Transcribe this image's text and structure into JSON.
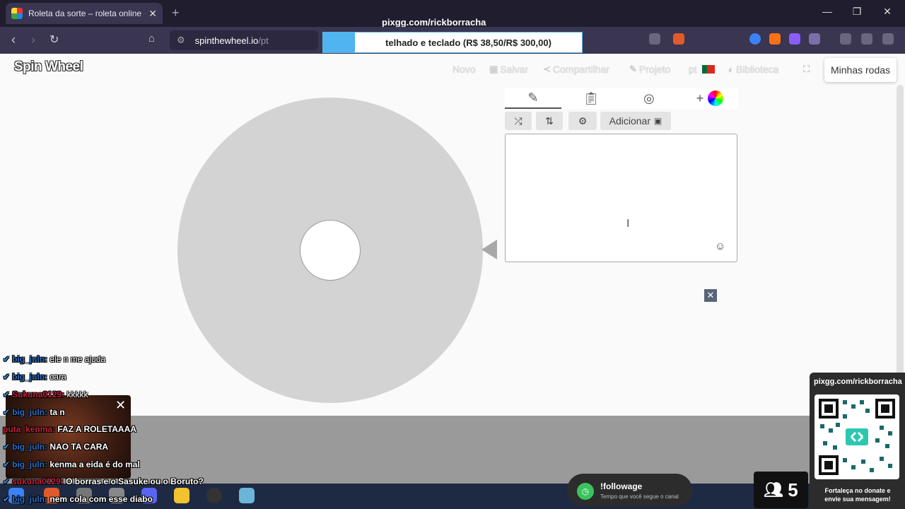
{
  "browser": {
    "tab_title": "Roleta da sorte – roleta online gr",
    "overlay_url": "pixgg.com/rickborracha",
    "address_site": "spinthewheel.io",
    "address_path": "/pt",
    "promo_text": "telhado e teclado (R$ 38,50/R$ 300,00)"
  },
  "site": {
    "logo": "Spin Wheel",
    "menu": {
      "novo": "Novo",
      "salvar": "Salvar",
      "compartilhar": "Compartilhar",
      "projeto": "Projeto",
      "lang": "pt",
      "biblioteca": "Biblioteca"
    },
    "minhas_rodas": "Minhas rodas"
  },
  "editor": {
    "add_label": "Adicionar",
    "entries_text": ""
  },
  "chat": [
    {
      "user": "big_juln:",
      "text": "ele n me ajuda"
    },
    {
      "user": "big_juln:",
      "text": "cara"
    },
    {
      "user": "Sukuna0129:",
      "text": "kkkkk"
    },
    {
      "user": "big_juln:",
      "text": "ta n"
    },
    {
      "user": "puta_kenma:",
      "text": "FAZ A ROLETAAAA"
    },
    {
      "user": "big_juln:",
      "text": "NAO TA CARA"
    },
    {
      "user": "big_juln:",
      "text": "kenma a eida é do mal"
    },
    {
      "user": "sukuna0129:",
      "text": "O borras e o Sasuke ou o Boruto?"
    },
    {
      "user": "big_juln:",
      "text": "nem cola com esse diabo"
    }
  ],
  "follow_widget": {
    "title": "!followage",
    "subtitle": "Tempo que você segue o canal"
  },
  "viewers": {
    "count": "5"
  },
  "qr_panel": {
    "url": "pixgg.com/rickborracha",
    "note_line1": "Fortaleça no donate e",
    "note_line2": "envie sua mensagem!"
  },
  "colors": {
    "wheel": "#d3d3d3",
    "promo_fill": "#4fb4ef",
    "follow_dot": "#3ac35e"
  },
  "icons": [
    "pencil-icon",
    "clipboard-icon",
    "eye-off-icon",
    "plus-icon",
    "color-wheel-icon",
    "shuffle-icon",
    "sort-icon",
    "gear-icon",
    "image-icon",
    "smiley-icon",
    "close-icon"
  ]
}
